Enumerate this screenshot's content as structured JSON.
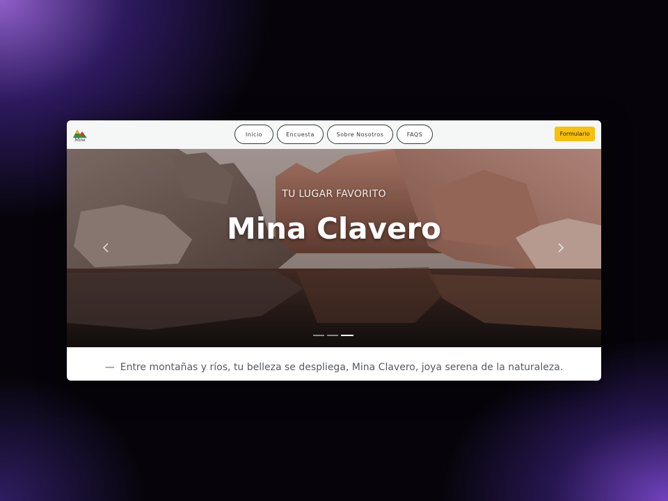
{
  "navbar": {
    "logo_text": "Mina",
    "links": [
      "Inicio",
      "Encuesta",
      "Sobre Nosotros",
      "FAQS"
    ],
    "form_button": "Formulario"
  },
  "hero": {
    "subtitle": "TU LUGAR FAVORITO",
    "title": "Mina Clavero",
    "prev_icon": "chevron-left-icon",
    "next_icon": "chevron-right-icon",
    "slide_count": 3,
    "active_slide": 3
  },
  "quote": {
    "dash": "—",
    "text": "Entre montañas y ríos, tu belleza se despliega, Mina Clavero, joya serena de la naturaleza."
  },
  "colors": {
    "form_button_bg": "#f8c00a",
    "navbar_bg": "#f5f7f7"
  }
}
